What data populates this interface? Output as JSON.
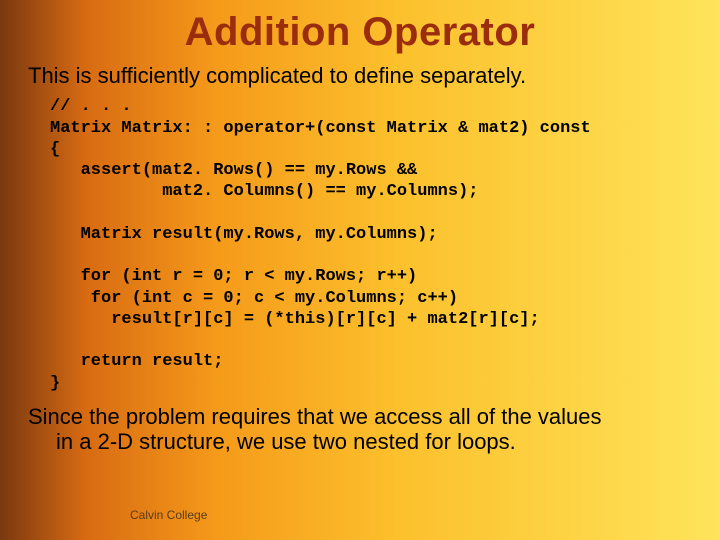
{
  "title": "Addition Operator",
  "intro": "This is sufficiently complicated to define separately.",
  "code": "// . . .\nMatrix Matrix: : operator+(const Matrix & mat2) const\n{\n   assert(mat2. Rows() == my.Rows &&\n           mat2. Columns() == my.Columns);\n\n   Matrix result(my.Rows, my.Columns);\n\n   for (int r = 0; r < my.Rows; r++)\n    for (int c = 0; c < my.Columns; c++)\n      result[r][c] = (*this)[r][c] + mat2[r][c];\n\n   return result;\n}",
  "outro_line1": "Since the problem requires that we access all of the values",
  "outro_line2": "in a 2-D structure, we use two nested for loops.",
  "footer": "Calvin College"
}
